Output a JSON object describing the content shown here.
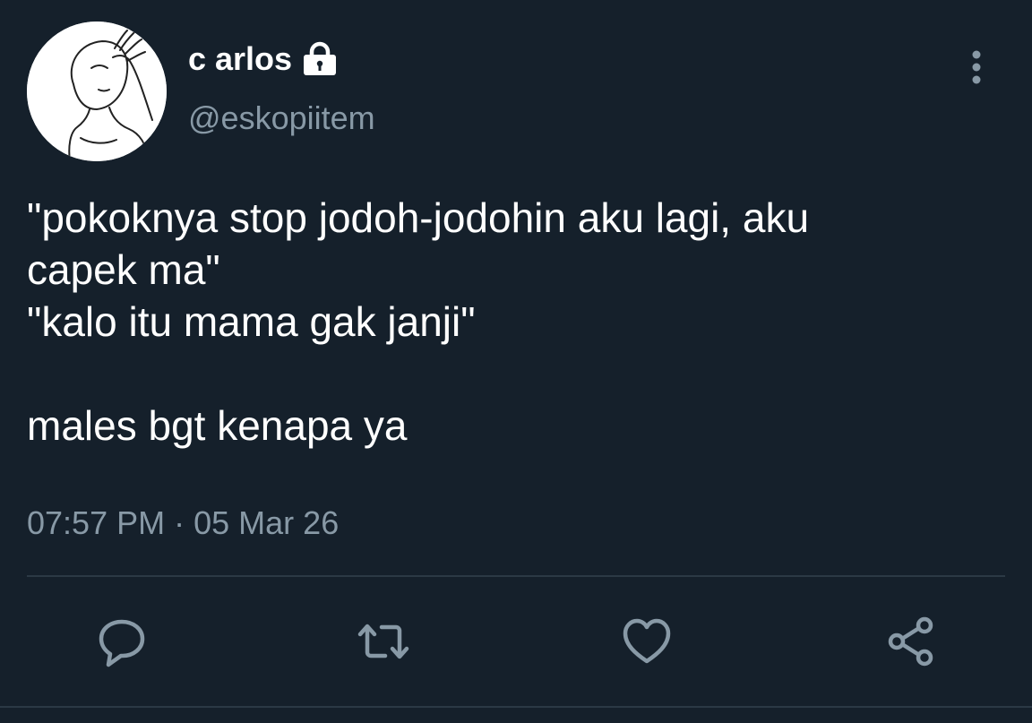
{
  "tweet": {
    "display_name": "c arlos",
    "handle": "@eskopiitem",
    "text": "\"pokoknya stop jodoh-jodohin aku lagi, aku\ncapek ma\"\n\"kalo itu mama gak janji\"\n\nmales bgt kenapa ya",
    "time": "07:57 PM",
    "separator": "·",
    "date": "05 Mar 26"
  },
  "icons": {
    "avatar": "facepalm-meme-avatar",
    "lock": "lock-icon",
    "more": "more-vertical-icon",
    "reply": "reply-icon",
    "retweet": "retweet-icon",
    "like": "heart-icon",
    "share": "share-icon"
  },
  "colors": {
    "background": "#15202b",
    "text_primary": "#ffffff",
    "text_secondary": "#8899a6",
    "divider": "#2b3945"
  }
}
